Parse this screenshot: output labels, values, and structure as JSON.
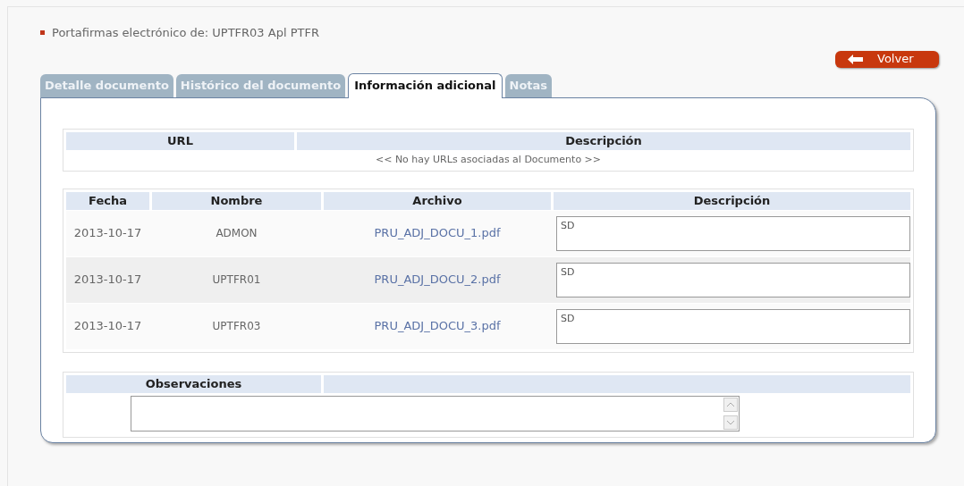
{
  "title": "Portafirmas electrónico de: UPTFR03 Apl PTFR",
  "back_button": "Volver",
  "tabs": [
    {
      "label": "Detalle documento",
      "selected": false
    },
    {
      "label": "Histórico del documento",
      "selected": false
    },
    {
      "label": "Información adicional",
      "selected": true
    },
    {
      "label": "Notas",
      "selected": false
    }
  ],
  "url_table": {
    "columns": [
      "URL",
      "Descripción"
    ],
    "empty_message": "<< No hay URLs asociadas al Documento >>"
  },
  "files_table": {
    "columns": [
      "Fecha",
      "Nombre",
      "Archivo",
      "Descripción"
    ],
    "rows": [
      {
        "date": "2013-10-17",
        "name": "ADMON",
        "file": "PRU_ADJ_DOCU_1.pdf",
        "description": "SD"
      },
      {
        "date": "2013-10-17",
        "name": "UPTFR01",
        "file": "PRU_ADJ_DOCU_2.pdf",
        "description": "SD"
      },
      {
        "date": "2013-10-17",
        "name": "UPTFR03",
        "file": "PRU_ADJ_DOCU_3.pdf",
        "description": "SD"
      }
    ]
  },
  "observations": {
    "label": "Observaciones"
  }
}
